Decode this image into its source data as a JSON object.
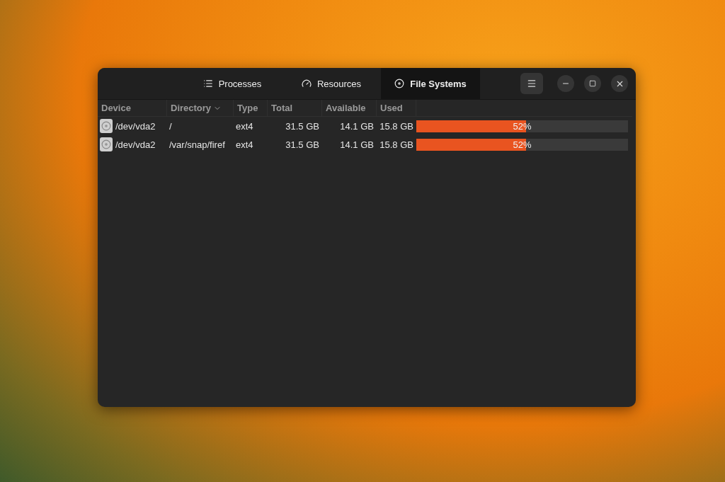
{
  "tabs": [
    {
      "label": "Processes",
      "kind": "list",
      "selected": false
    },
    {
      "label": "Resources",
      "kind": "gauge",
      "selected": false
    },
    {
      "label": "File Systems",
      "kind": "disk",
      "selected": true
    }
  ],
  "table": {
    "columns": [
      {
        "label": "Device",
        "sorted": false
      },
      {
        "label": "Directory",
        "sorted": true
      },
      {
        "label": "Type",
        "sorted": false
      },
      {
        "label": "Total",
        "sorted": false
      },
      {
        "label": "Available",
        "sorted": false
      },
      {
        "label": "Used",
        "sorted": false
      }
    ],
    "rows": [
      {
        "device": "/dev/vda2",
        "directory": "/",
        "type": "ext4",
        "total": "31.5 GB",
        "available": "14.1 GB",
        "used": "15.8 GB",
        "level": 0.52,
        "reading": "52%"
      },
      {
        "device": "/dev/vda2",
        "directory": "/var/snap/firef",
        "type": "ext4",
        "total": "31.5 GB",
        "available": "14.1 GB",
        "used": "15.8 GB",
        "level": 0.52,
        "reading": "52%"
      }
    ]
  }
}
